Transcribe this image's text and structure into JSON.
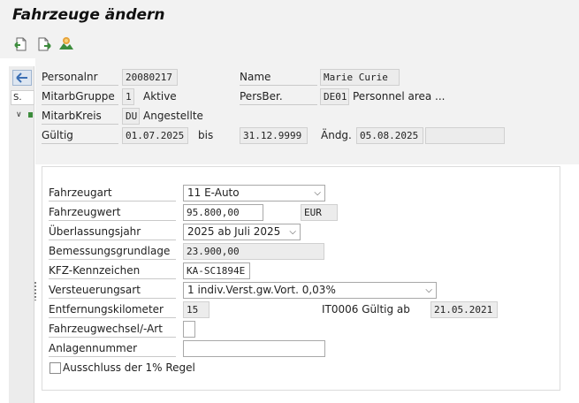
{
  "window": {
    "title": "Fahrzeuge ändern"
  },
  "toolbar": {
    "buttons": [
      {
        "icon": "previous-record-icon"
      },
      {
        "icon": "next-record-icon"
      },
      {
        "icon": "overview-icon"
      }
    ]
  },
  "nav": {
    "tab_label": "S."
  },
  "header": {
    "personalnr_label": "Personalnr",
    "personalnr_value": "20080217",
    "name_label": "Name",
    "name_value": "Marie Curie",
    "mitarbgruppe_label": "MitarbGruppe",
    "mitarbgruppe_value": "1",
    "mitarbgruppe_text": "Aktive",
    "persber_label": "PersBer.",
    "persber_value": "DE01",
    "persber_text": "Personnel area ...",
    "mitarbkreis_label": "MitarbKreis",
    "mitarbkreis_value": "DU",
    "mitarbkreis_text": "Angestellte",
    "gueltig_label": "Gültig",
    "gueltig_from": "01.07.2025",
    "bis_label": "bis",
    "gueltig_to": "31.12.9999",
    "aendg_label": "Ändg.",
    "aendg_value": "05.08.2025"
  },
  "form": {
    "fahrzeugart_label": "Fahrzeugart",
    "fahrzeugart_value": "11 E-Auto",
    "fahrzeugwert_label": "Fahrzeugwert",
    "fahrzeugwert_value": "95.800,00",
    "waehrung_value": "EUR",
    "ueberlassungsjahr_label": "Überlassungsjahr",
    "ueberlassungsjahr_value": "2025 ab Juli 2025",
    "bemessungsgrundlage_label": "Bemessungsgrundlage",
    "bemessungsgrundlage_value": "23.900,00",
    "kfz_label": "KFZ-Kennzeichen",
    "kfz_value": "KA-SC1894E",
    "versteuerungsart_label": "Versteuerungsart",
    "versteuerungsart_value": "1 indiv.Verst.gw.Vort. 0,03%",
    "entfernung_label": "Entfernungskilometer",
    "entfernung_value": "15",
    "it0006_label": "IT0006 Gültig ab",
    "it0006_value": "21.05.2021",
    "fahrzeugwechsel_label": "Fahrzeugwechsel/-Art",
    "anlagennummer_label": "Anlagennummer",
    "anlagennummer_value": "",
    "ausschluss_label": "Ausschluss der 1% Regel",
    "ausschluss_checked": false
  },
  "colors": {
    "background_bar": "#f2f2f2",
    "readonly_field": "#ececec",
    "icon_green": "#3c8c3c",
    "icon_orange": "#e8a33a"
  }
}
